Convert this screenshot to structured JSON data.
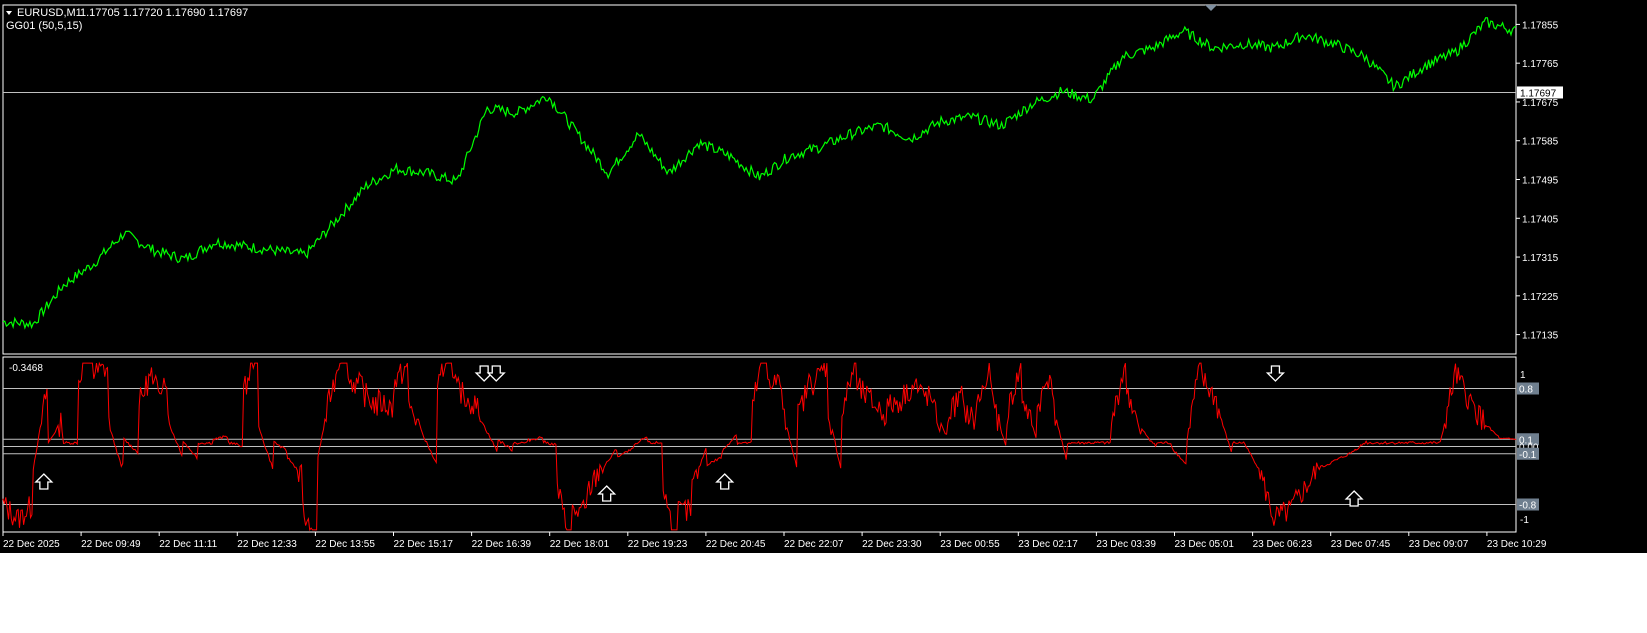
{
  "header": {
    "symbol": "EURUSD,M1",
    "ohlc": "1.17705 1.17720 1.17690 1.17697",
    "indicator": "GG01 (50,5,15)"
  },
  "colors": {
    "background": "#000000",
    "price_line": "#00ff00",
    "oscillator_line": "#ff0000",
    "level_line": "#c0c0c0",
    "axis_text": "#ffffff",
    "level_tag_bg": "#6f7f8f"
  },
  "icons": {
    "buy_arrow": "up-arrow-icon",
    "sell_arrow": "down-arrow-icon",
    "collapse_triangle": "triangle-down-icon"
  },
  "chart_data": [
    {
      "type": "line",
      "panel": "price",
      "series_name": "EURUSD,M1",
      "ylim": [
        1.1709,
        1.179
      ],
      "y_ticks": [
        "1.17855",
        "1.17765",
        "1.17675",
        "1.17585",
        "1.17495",
        "1.17405",
        "1.17315",
        "1.17225",
        "1.17135"
      ],
      "current_price": "1.17697",
      "x": [
        0,
        0.02,
        0.04,
        0.06,
        0.08,
        0.1,
        0.12,
        0.14,
        0.16,
        0.18,
        0.2,
        0.22,
        0.24,
        0.26,
        0.28,
        0.3,
        0.32,
        0.34,
        0.36,
        0.38,
        0.4,
        0.42,
        0.44,
        0.46,
        0.48,
        0.5,
        0.52,
        0.54,
        0.56,
        0.58,
        0.6,
        0.62,
        0.64,
        0.66,
        0.68,
        0.7,
        0.72,
        0.74,
        0.76,
        0.78,
        0.8,
        0.82,
        0.84,
        0.86,
        0.88,
        0.9,
        0.92,
        0.94,
        0.96,
        0.98,
        1.0
      ],
      "values": [
        1.17165,
        1.1716,
        1.1725,
        1.173,
        1.1737,
        1.1733,
        1.1731,
        1.1735,
        1.1734,
        1.1733,
        1.1732,
        1.174,
        1.1748,
        1.1752,
        1.1751,
        1.1749,
        1.1766,
        1.1765,
        1.1769,
        1.176,
        1.1751,
        1.176,
        1.1751,
        1.1758,
        1.1755,
        1.175,
        1.1755,
        1.1757,
        1.176,
        1.1762,
        1.1759,
        1.1763,
        1.1764,
        1.1762,
        1.1767,
        1.177,
        1.1768,
        1.1778,
        1.178,
        1.1784,
        1.178,
        1.1781,
        1.178,
        1.1783,
        1.1781,
        1.1778,
        1.1771,
        1.1776,
        1.1779,
        1.1786,
        1.1784
      ]
    },
    {
      "type": "line",
      "panel": "oscillator",
      "series_name": "GG01 (50,5,15)",
      "ylim": [
        -1,
        1
      ],
      "current_value": "-0.3468",
      "levels": [
        0.8,
        0.1,
        0.0,
        -0.1,
        -0.8
      ],
      "level_tags": [
        "0.8",
        "0.1",
        "0.00",
        "-0.1",
        "-0.8"
      ],
      "y_ticks": [
        "1",
        "-1"
      ],
      "x": [
        0,
        0.01,
        0.015,
        0.02,
        0.03,
        0.04,
        0.05,
        0.06,
        0.07,
        0.08,
        0.09,
        0.1,
        0.11,
        0.12,
        0.13,
        0.14,
        0.15,
        0.16,
        0.17,
        0.18,
        0.19,
        0.2,
        0.21,
        0.22,
        0.23,
        0.24,
        0.25,
        0.26,
        0.27,
        0.28,
        0.29,
        0.3,
        0.31,
        0.32,
        0.33,
        0.34,
        0.35,
        0.36,
        0.37,
        0.38,
        0.39,
        0.4,
        0.41,
        0.42,
        0.43,
        0.44,
        0.45,
        0.46,
        0.47,
        0.48,
        0.49,
        0.5,
        0.51,
        0.52,
        0.53,
        0.54,
        0.55,
        0.56,
        0.57,
        0.58,
        0.59,
        0.6,
        0.61,
        0.62,
        0.63,
        0.64,
        0.65,
        0.66,
        0.67,
        0.68,
        0.69,
        0.7,
        0.71,
        0.72,
        0.73,
        0.74,
        0.75,
        0.76,
        0.77,
        0.78,
        0.79,
        0.8,
        0.81,
        0.82,
        0.83,
        0.84,
        0.85,
        0.86,
        0.87,
        0.88,
        0.89,
        0.9,
        0.91,
        0.92,
        0.93,
        0.94,
        0.95,
        0.96,
        0.97,
        0.98,
        0.99,
        1.0
      ],
      "values": [
        -0.8,
        -1.0,
        -0.9,
        -0.3,
        0.05,
        0.05,
        0.9,
        1.0,
        0.3,
        0.1,
        0.6,
        0.8,
        0.3,
        0.05,
        0.05,
        0.1,
        0.05,
        0.8,
        0.2,
        0.05,
        -0.2,
        -1.0,
        0.05,
        1.0,
        0.9,
        0.7,
        0.6,
        0.9,
        0.5,
        0.05,
        1.0,
        0.8,
        0.6,
        0.2,
        0.05,
        0.05,
        0.1,
        0.05,
        -0.9,
        -0.9,
        -0.5,
        -0.2,
        -0.1,
        0.05,
        0.05,
        -0.9,
        -0.9,
        -0.3,
        -0.2,
        0.05,
        0.05,
        1.0,
        0.9,
        0.1,
        0.7,
        1.0,
        0.05,
        0.9,
        0.7,
        0.5,
        0.6,
        0.8,
        0.7,
        0.3,
        0.6,
        0.4,
        0.9,
        0.2,
        0.9,
        0.3,
        0.9,
        0.05,
        0.05,
        0.05,
        0.05,
        1.0,
        0.3,
        0.05,
        0.05,
        -0.2,
        1.0,
        0.7,
        0.05,
        0.05,
        -0.3,
        -1.0,
        -0.9,
        -0.6,
        -0.3,
        -0.2,
        -0.1,
        0.05,
        0.05,
        0.05,
        0.05,
        0.05,
        0.05,
        1.0,
        0.6,
        0.3,
        0.1,
        0.1
      ]
    }
  ],
  "signals": {
    "sell": [
      0.318,
      0.326,
      0.841
    ],
    "buy": [
      0.027,
      0.399,
      0.477,
      0.893
    ]
  },
  "x_axis_labels": [
    "22 Dec 2025",
    "22 Dec 09:49",
    "22 Dec 11:11",
    "22 Dec 12:33",
    "22 Dec 13:55",
    "22 Dec 15:17",
    "22 Dec 16:39",
    "22 Dec 18:01",
    "22 Dec 19:23",
    "22 Dec 20:45",
    "22 Dec 22:07",
    "22 Dec 23:30",
    "23 Dec 00:55",
    "23 Dec 02:17",
    "23 Dec 03:39",
    "23 Dec 05:01",
    "23 Dec 06:23",
    "23 Dec 07:45",
    "23 Dec 09:07",
    "23 Dec 10:29"
  ]
}
